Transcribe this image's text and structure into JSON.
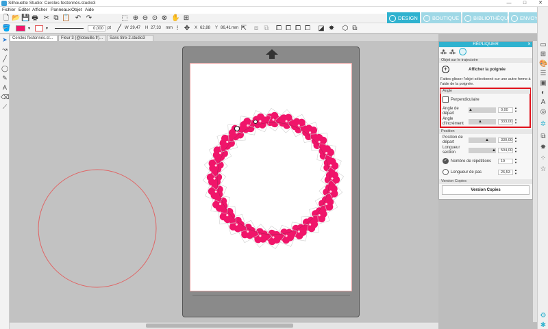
{
  "window": {
    "title": "Silhouette Studio: Cercles festonnés.studio3",
    "controls": [
      "—",
      "□",
      "✕"
    ]
  },
  "menu": [
    "Fichier",
    "Editer",
    "Afficher",
    "Panneaux",
    "Objet",
    "Aide"
  ],
  "nav_tabs": [
    "DESIGN",
    "BOUTIQUE",
    "BIBLIOTHÈQUE",
    "ENVOYER"
  ],
  "toolbar": {
    "line_width": "0,000",
    "line_unit": "pt",
    "w_label": "W",
    "w_value": "29,47",
    "h_label": "H",
    "h_value": "27,33",
    "size_unit": "mm",
    "x_label": "X",
    "x_value": "62,88",
    "y_label": "Y",
    "y_value": "86,41",
    "pos_unit": "mm"
  },
  "doc_tabs": [
    "Cercles festonnés.st...",
    "Fleur 3 (@lotouille.fr)...",
    "Sans titre-2.studio3"
  ],
  "panel": {
    "title": "RÉPLIQUER",
    "section_path": "Objet sur le trajectoire",
    "show_handle": "Afficher la poignée",
    "help_text": "Faites glisser l'objet sélectionné sur une autre forme à l'aide de la poignée.",
    "angle_section": "Angle",
    "perpendicular": "Perpendiculaire",
    "start_angle_label": "Angle de départ",
    "start_angle_value": "0,00",
    "increment_angle_label": "Angle d'incrément",
    "increment_angle_value": "333,00",
    "position_section": "Position",
    "start_pos_label": "Position de départ",
    "start_pos_value": "330,00",
    "section_length_label": "Longueur section",
    "section_length_value": "504,00",
    "repetitions_label": "Nombre de répétitions",
    "repetitions_value": "19",
    "step_length_label": "Longueur de pas",
    "step_length_value": "26,53",
    "copies_section": "Version Copies",
    "copies_button": "Version Copies"
  },
  "colors": {
    "accent": "#2fb2cf",
    "flower": "#f0156a",
    "highlight_border": "#e0101a",
    "circle_stroke": "#e06464"
  }
}
